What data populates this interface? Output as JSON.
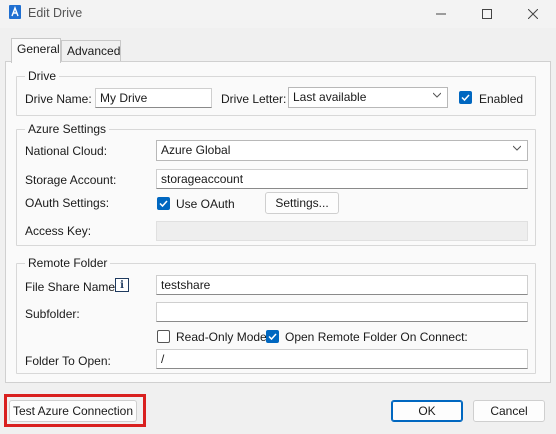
{
  "window": {
    "title": "Edit Drive",
    "icons": {
      "app": "azure-drive-icon",
      "minimize": "minimize-icon",
      "maximize": "maximize-icon",
      "close": "close-icon"
    }
  },
  "tabs": [
    {
      "label": "General",
      "active": true
    },
    {
      "label": "Advanced",
      "active": false
    }
  ],
  "drive": {
    "group_title": "Drive",
    "name_label": "Drive Name:",
    "name_value": "My Drive",
    "letter_label": "Drive Letter:",
    "letter_value": "Last available",
    "enabled_label": "Enabled",
    "enabled_checked": true
  },
  "azure": {
    "group_title": "Azure Settings",
    "cloud_label": "National Cloud:",
    "cloud_value": "Azure Global",
    "storage_label": "Storage Account:",
    "storage_value": "storageaccount",
    "oauth_label": "OAuth Settings:",
    "use_oauth_label": "Use OAuth",
    "use_oauth_checked": true,
    "settings_button": "Settings...",
    "access_key_label": "Access Key:",
    "access_key_value": ""
  },
  "remote": {
    "group_title": "Remote Folder",
    "share_label": "File Share Name:",
    "share_value": "testshare",
    "subfolder_label": "Subfolder:",
    "subfolder_value": "",
    "readonly_label": "Read-Only Mode",
    "readonly_checked": false,
    "open_remote_label": "Open Remote Folder On Connect:",
    "open_remote_checked": true,
    "folder_open_label": "Folder To Open:",
    "folder_open_value": "/"
  },
  "footer": {
    "test_button": "Test Azure Connection",
    "ok_button": "OK",
    "cancel_button": "Cancel"
  },
  "colors": {
    "accent": "#0067c0",
    "highlight": "#d9201f"
  }
}
